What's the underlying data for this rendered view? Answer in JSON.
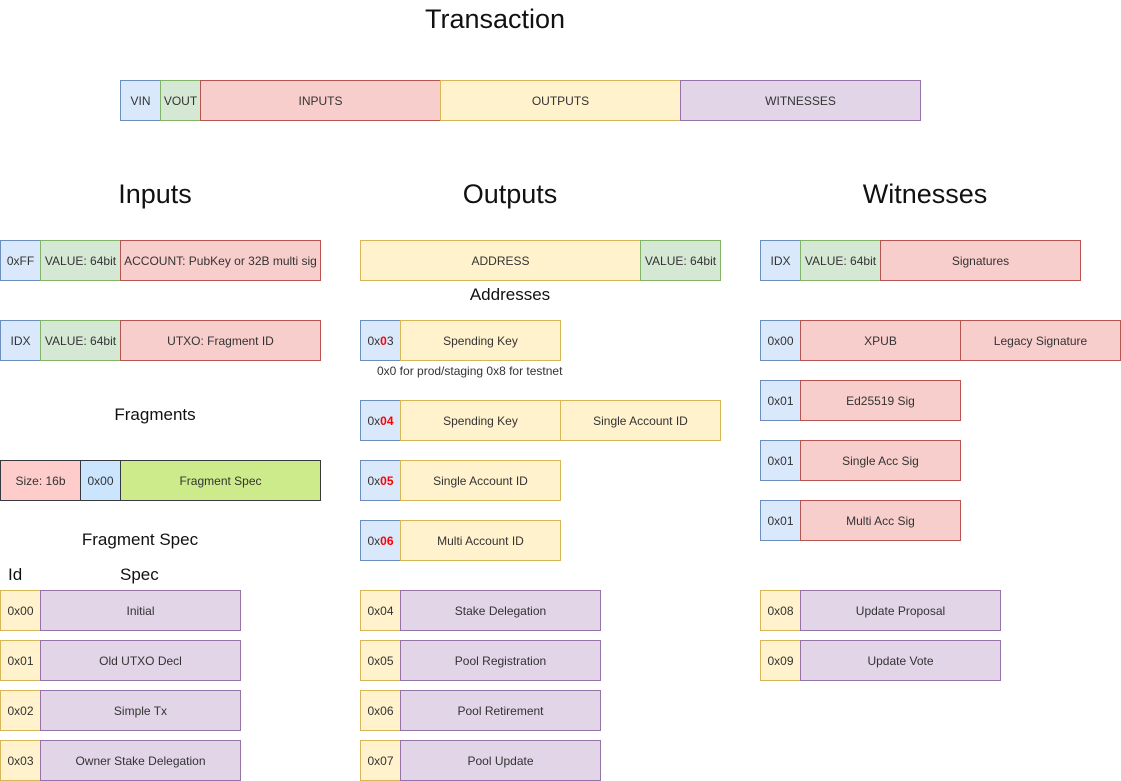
{
  "titles": {
    "transaction": "Transaction",
    "inputs": "Inputs",
    "outputs": "Outputs",
    "witnesses": "Witnesses",
    "addresses": "Addresses",
    "fragments": "Fragments",
    "fragment_spec": "Fragment Spec",
    "col_id": "Id",
    "col_spec": "Spec"
  },
  "transaction_bar": [
    "VIN",
    "VOUT",
    "INPUTS",
    "OUTPUTS",
    "WITNESSES"
  ],
  "inputs": {
    "account_row": [
      "0xFF",
      "VALUE:  64bit",
      "ACCOUNT: PubKey or 32B multi sig"
    ],
    "utxo_row": [
      "IDX",
      "VALUE:  64bit",
      "UTXO: Fragment ID"
    ]
  },
  "fragments": {
    "row": [
      "Size: 16b",
      "0x00",
      "Fragment Spec"
    ]
  },
  "fragment_spec": [
    {
      "id": "0x00",
      "spec": "Initial"
    },
    {
      "id": "0x01",
      "spec": "Old UTXO Decl"
    },
    {
      "id": "0x02",
      "spec": "Simple Tx"
    },
    {
      "id": "0x03",
      "spec": "Owner Stake Delegation"
    },
    {
      "id": "0x04",
      "spec": "Stake Delegation"
    },
    {
      "id": "0x05",
      "spec": "Pool Registration"
    },
    {
      "id": "0x06",
      "spec": "Pool Retirement"
    },
    {
      "id": "0x07",
      "spec": "Pool Update"
    },
    {
      "id": "0x08",
      "spec": "Update Proposal"
    },
    {
      "id": "0x09",
      "spec": "Update Vote"
    }
  ],
  "outputs": {
    "row": [
      "ADDRESS",
      "VALUE:  64bit"
    ]
  },
  "addresses": [
    {
      "prefix": "0x",
      "highlight": "0",
      "suffix": "3",
      "parts": [
        "Spending Key"
      ]
    },
    {
      "prefix": "0x",
      "highlight": "04",
      "suffix": "",
      "parts": [
        "Spending Key",
        "Single Account ID"
      ]
    },
    {
      "prefix": "0x",
      "highlight": "05",
      "suffix": "",
      "parts": [
        "Single Account ID"
      ]
    },
    {
      "prefix": "0x",
      "highlight": "06",
      "suffix": "",
      "parts": [
        "Multi Account ID"
      ]
    }
  ],
  "address_note": "0x0 for prod/staging 0x8 for testnet",
  "witnesses": {
    "row": [
      "IDX",
      "VALUE:  64bit",
      "Signatures"
    ],
    "types": [
      {
        "id": "0x00",
        "parts": [
          "XPUB",
          "Legacy Signature"
        ]
      },
      {
        "id": "0x01",
        "parts": [
          "Ed25519 Sig"
        ]
      },
      {
        "id": "0x01",
        "parts": [
          "Single Acc Sig"
        ]
      },
      {
        "id": "0x01",
        "parts": [
          "Multi Acc Sig"
        ]
      }
    ]
  },
  "colors": {
    "blue": "#dae8fc",
    "green": "#d5e8d4",
    "red": "#f8cecc",
    "yellow": "#fff2cc",
    "purple": "#e1d5e7",
    "lime": "#cdeb8b",
    "highlight": "#ff0000"
  }
}
